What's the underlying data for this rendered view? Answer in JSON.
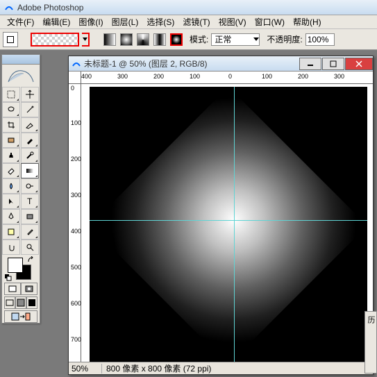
{
  "app": {
    "title": "Adobe Photoshop"
  },
  "menu": {
    "file": "文件(F)",
    "edit": "编辑(E)",
    "image": "图像(I)",
    "layer": "图层(L)",
    "select": "选择(S)",
    "filter": "滤镜(T)",
    "view": "视图(V)",
    "window": "窗口(W)",
    "help": "帮助(H)"
  },
  "options": {
    "mode_label": "模式:",
    "mode_value": "正常",
    "opacity_label": "不透明度:",
    "opacity_value": "100%",
    "gradient_types": [
      "linear",
      "radial",
      "angle",
      "reflected",
      "diamond"
    ],
    "selected_gradient_type": "diamond"
  },
  "document": {
    "title": "未标题-1 @ 50% (图层 2, RGB/8)",
    "zoom": "50%",
    "info": "800 像素 x 800 像素 (72 ppi)",
    "ruler_h": [
      "400",
      "300",
      "200",
      "100",
      "0",
      "100",
      "200",
      "300"
    ],
    "ruler_v": [
      "0",
      "100",
      "200",
      "300",
      "400",
      "500",
      "600",
      "700"
    ]
  },
  "palette": {
    "tab": "历"
  },
  "colors": {
    "fg": "#ffffff",
    "bg": "#000000"
  }
}
